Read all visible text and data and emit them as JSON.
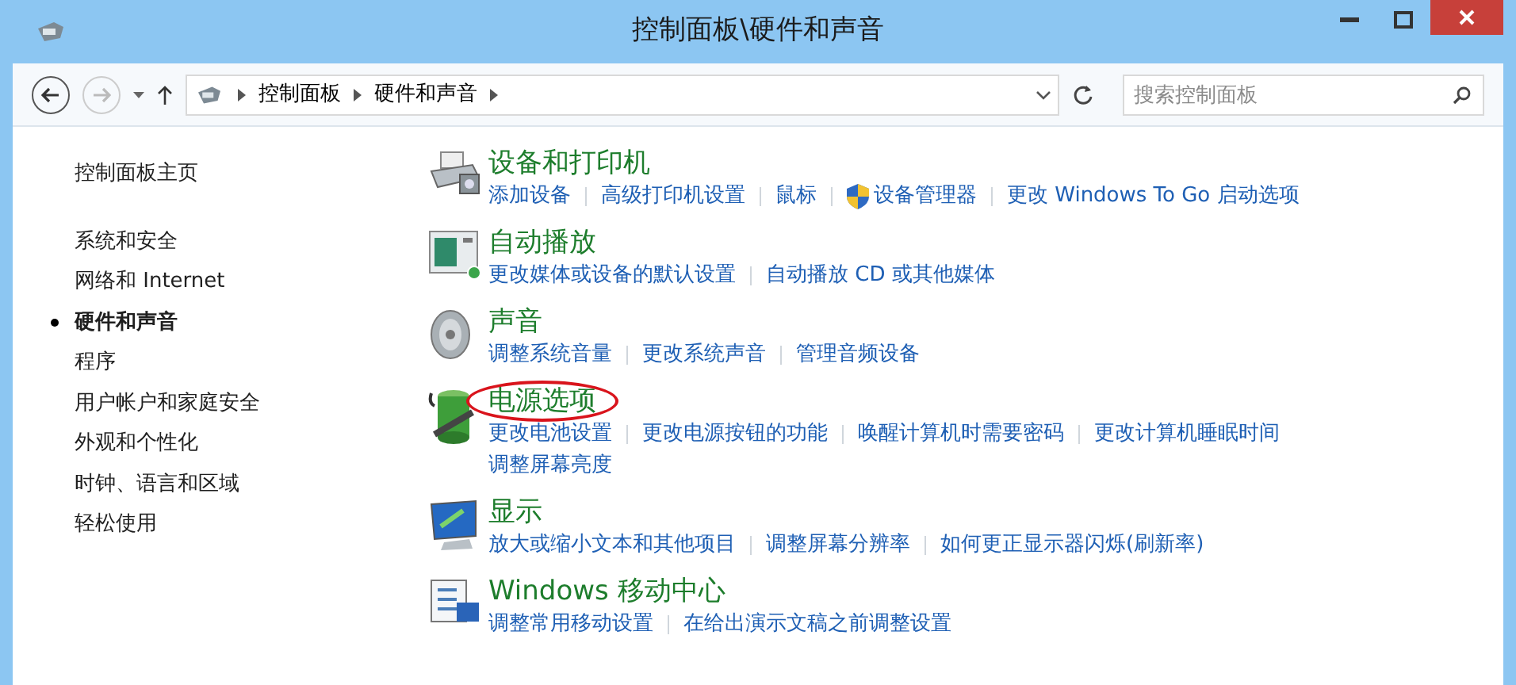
{
  "window": {
    "title": "控制面板\\硬件和声音"
  },
  "address_bar": {
    "breadcrumb": [
      "控制面板",
      "硬件和声音"
    ],
    "search": {
      "placeholder": "搜索控制面板"
    }
  },
  "sidebar": {
    "home": "控制面板主页",
    "items": [
      {
        "label": "系统和安全",
        "selected": false
      },
      {
        "label": "网络和 Internet",
        "selected": false
      },
      {
        "label": "硬件和声音",
        "selected": true
      },
      {
        "label": "程序",
        "selected": false
      },
      {
        "label": "用户帐户和家庭安全",
        "selected": false
      },
      {
        "label": "外观和个性化",
        "selected": false
      },
      {
        "label": "时钟、语言和区域",
        "selected": false
      },
      {
        "label": "轻松使用",
        "selected": false
      }
    ]
  },
  "categories": [
    {
      "kind": "printer",
      "title": "设备和打印机",
      "highlighted": false,
      "link_rows": [
        [
          {
            "text": "添加设备",
            "shield": false
          },
          {
            "text": "高级打印机设置",
            "shield": false
          },
          {
            "text": "鼠标",
            "shield": false
          },
          {
            "text": "设备管理器",
            "shield": true
          },
          {
            "text": "更改 Windows To Go 启动选项",
            "shield": false
          }
        ]
      ]
    },
    {
      "kind": "autoplay",
      "title": "自动播放",
      "highlighted": false,
      "link_rows": [
        [
          {
            "text": "更改媒体或设备的默认设置",
            "shield": false
          },
          {
            "text": "自动播放 CD 或其他媒体",
            "shield": false
          }
        ]
      ]
    },
    {
      "kind": "speaker",
      "title": "声音",
      "highlighted": false,
      "link_rows": [
        [
          {
            "text": "调整系统音量",
            "shield": false
          },
          {
            "text": "更改系统声音",
            "shield": false
          },
          {
            "text": "管理音频设备",
            "shield": false
          }
        ]
      ]
    },
    {
      "kind": "battery",
      "title": "电源选项",
      "highlighted": true,
      "link_rows": [
        [
          {
            "text": "更改电池设置",
            "shield": false
          },
          {
            "text": "更改电源按钮的功能",
            "shield": false
          },
          {
            "text": "唤醒计算机时需要密码",
            "shield": false
          },
          {
            "text": "更改计算机睡眠时间",
            "shield": false
          }
        ],
        [
          {
            "text": "调整屏幕亮度",
            "shield": false
          }
        ]
      ]
    },
    {
      "kind": "display",
      "title": "显示",
      "highlighted": false,
      "link_rows": [
        [
          {
            "text": "放大或缩小文本和其他项目",
            "shield": false
          },
          {
            "text": "调整屏幕分辨率",
            "shield": false
          },
          {
            "text": "如何更正显示器闪烁(刷新率)",
            "shield": false
          }
        ]
      ]
    },
    {
      "kind": "mobility",
      "title": "Windows 移动中心",
      "highlighted": false,
      "link_rows": [
        [
          {
            "text": "调整常用移动设置",
            "shield": false
          },
          {
            "text": "在给出演示文稿之前调整设置",
            "shield": false
          }
        ]
      ]
    }
  ]
}
